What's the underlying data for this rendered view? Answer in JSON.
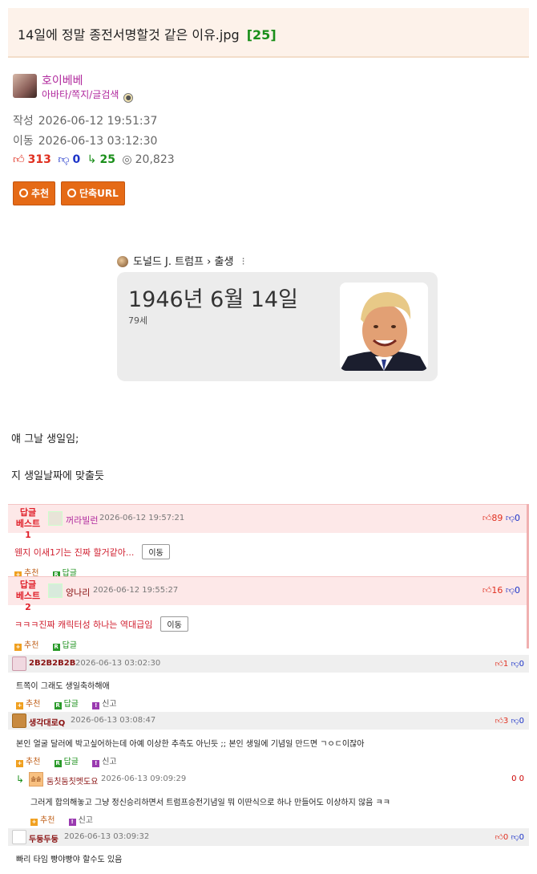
{
  "post": {
    "title": "14일에 정말 종전서명할것 같은 이유.jpg",
    "comment_count": "[25]",
    "author": {
      "nickname": "호이베베",
      "links": "아바타/쪽지/글검색"
    },
    "created_label": "작성",
    "created": "2026-06-12 19:51:37",
    "moved_label": "이동",
    "moved": "2026-06-13 03:12:30",
    "stats": {
      "up": "313",
      "down": "0",
      "replies": "25",
      "views": "20,823"
    },
    "buttons": {
      "recommend": "추천",
      "short_url": "단축URL"
    },
    "embed": {
      "crumb_name": "도널드 J. 트럼프",
      "crumb_sep": "›",
      "crumb_sub": "출생",
      "more": "⁝",
      "date": "1946년 6월 14일",
      "age": "79세"
    },
    "body": [
      "얘 그날 생일임;",
      "지 생일날짜에 맞출듯"
    ]
  },
  "best_comments": [
    {
      "label1": "답글",
      "label2": "베스트1",
      "nick": "꺼라빌런",
      "time": "2026-06-12 19:57:21",
      "up": "89",
      "down": "0",
      "text": "웬지 이새1기는 진짜 할거같아...",
      "move": "이동",
      "recommend": "추천",
      "reply": "답글"
    },
    {
      "label1": "답글",
      "label2": "베스트2",
      "nick": "양나리",
      "time": "2026-06-12 19:55:27",
      "up": "16",
      "down": "0",
      "text": "ㅋㅋㅋ진짜 캐릭터성 하나는 역대급임",
      "move": "이동",
      "recommend": "추천",
      "reply": "답글"
    }
  ],
  "comments": [
    {
      "nick": "2B2B2B2B",
      "time": "2026-06-13 03:02:30",
      "up": "1",
      "down": "0",
      "text": "트쪽이 그래도 생일축하해애",
      "recommend": "추천",
      "reply": "답글",
      "report": "신고"
    },
    {
      "nick": "생각대로Q",
      "time": "2026-06-13 03:08:47",
      "up": "3",
      "down": "0",
      "text": "본인 얼굴 달러에 박고싶어하는데 아예 이상한 추측도 아닌듯 ;; 본인 생일에 기념일 만드면 ㄱㅇㄷ이잖아",
      "recommend": "추천",
      "reply": "답글",
      "report": "신고"
    },
    {
      "nick": "두둥두둥",
      "time": "2026-06-13 03:09:32",
      "up": "0",
      "down": "0",
      "text": "빠리 타임 빵야빵야 할수도 있음"
    }
  ],
  "reply": {
    "avatar_text": "솔솔",
    "nick": "둠칫둠칫멧도요",
    "time": "2026-06-13 09:09:29",
    "score": "0 0",
    "text": "그러게 합의해놓고 그냥 정신승리하면서 트럼프승전기념일 뭐 이딴식으로 하나 만들어도 이상하지 않음 ㅋㅋ",
    "recommend": "추천",
    "report": "신고"
  },
  "icons": {
    "thumb_up": "thumbs-up-icon",
    "thumb_down": "thumbs-down-icon",
    "reply": "reply-arrow-icon",
    "view": "eye-icon"
  },
  "colors": {
    "accent": "#e56a16",
    "up": "#e03020",
    "down": "#1c33c8",
    "reply": "#1a8f1a",
    "nick": "#b12b9e"
  }
}
